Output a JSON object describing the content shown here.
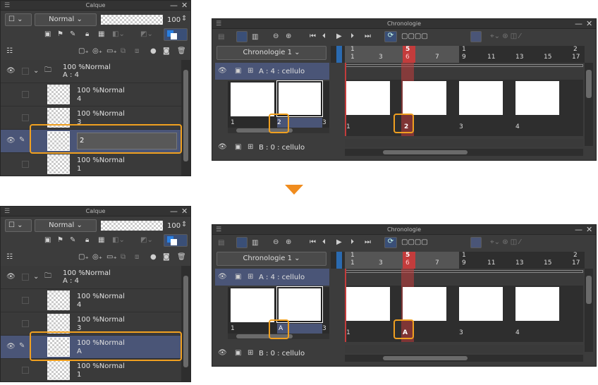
{
  "layer_panel": {
    "title": "Calque",
    "blend_mode": "Normal",
    "opacity": "100",
    "folder": {
      "opacity": "100 %",
      "mode": "Normal",
      "name": "A : 4"
    },
    "layers_before": [
      {
        "opacity": "100 %",
        "mode": "Normal",
        "name": "4"
      },
      {
        "opacity": "100 %",
        "mode": "Normal",
        "name": "3"
      },
      {
        "opacity": "100 %",
        "mode": "Normal",
        "name": "2",
        "editing": true
      },
      {
        "opacity": "100 %",
        "mode": "Normal",
        "name": "1"
      }
    ],
    "layers_after": [
      {
        "opacity": "100 %",
        "mode": "Normal",
        "name": "4"
      },
      {
        "opacity": "100 %",
        "mode": "Normal",
        "name": "3"
      },
      {
        "opacity": "100 %",
        "mode": "Normal",
        "name": "A"
      },
      {
        "opacity": "100 %",
        "mode": "Normal",
        "name": "1"
      }
    ]
  },
  "timeline_panel": {
    "title": "Chronologie",
    "timeline_name": "Chronologie 1",
    "track_a": "A : 4 : cellulo",
    "track_b": "B : 0 : cellulo",
    "current_frame_top": "5",
    "current_frame_bottom": "6",
    "ruler_top": [
      "1",
      "1",
      "2"
    ],
    "ruler_bottom": [
      "1",
      "3",
      "7",
      "9",
      "11",
      "13",
      "15",
      "17"
    ],
    "cel_labels_left": [
      "1",
      "3"
    ],
    "cel_labels_track": [
      "1",
      "3",
      "4"
    ],
    "before": {
      "selected_cel": "2",
      "track_cel": "2"
    },
    "after": {
      "selected_cel": "A",
      "track_cel": "A"
    }
  },
  "colors": {
    "accent": "#f0a020",
    "arrow": "#f08c1e",
    "playhead": "#c33c3c",
    "selection": "#4a5577"
  },
  "icons": [
    "eye-icon",
    "pencil-icon",
    "folder-icon",
    "chevron-down-icon",
    "trash-icon",
    "zoom-in-icon",
    "zoom-out-icon",
    "play-icon",
    "loop-icon"
  ]
}
